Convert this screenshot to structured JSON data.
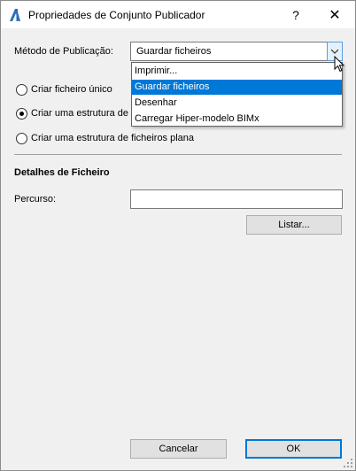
{
  "window": {
    "title": "Propriedades de Conjunto Publicador",
    "help_glyph": "?",
    "close_glyph": "✕"
  },
  "method": {
    "label": "Método de Publicação:",
    "selected": "Guardar ficheiros",
    "options": [
      "Imprimir...",
      "Guardar ficheiros",
      "Desenhar",
      "Carregar Hiper-modelo BIMx"
    ],
    "selected_index": 1
  },
  "radios": [
    {
      "label": "Criar ficheiro único",
      "checked": false
    },
    {
      "label": "Criar uma estrutura de",
      "checked": true
    },
    {
      "label": "Criar uma estrutura de ficheiros plana",
      "checked": false
    }
  ],
  "details": {
    "heading": "Detalhes de Ficheiro",
    "path_label": "Percurso:",
    "path_value": "",
    "browse_label": "Listar..."
  },
  "footer": {
    "cancel_label": "Cancelar",
    "ok_label": "OK"
  },
  "colors": {
    "highlight": "#0078d7",
    "dialog_bg": "#f0f0f0"
  }
}
